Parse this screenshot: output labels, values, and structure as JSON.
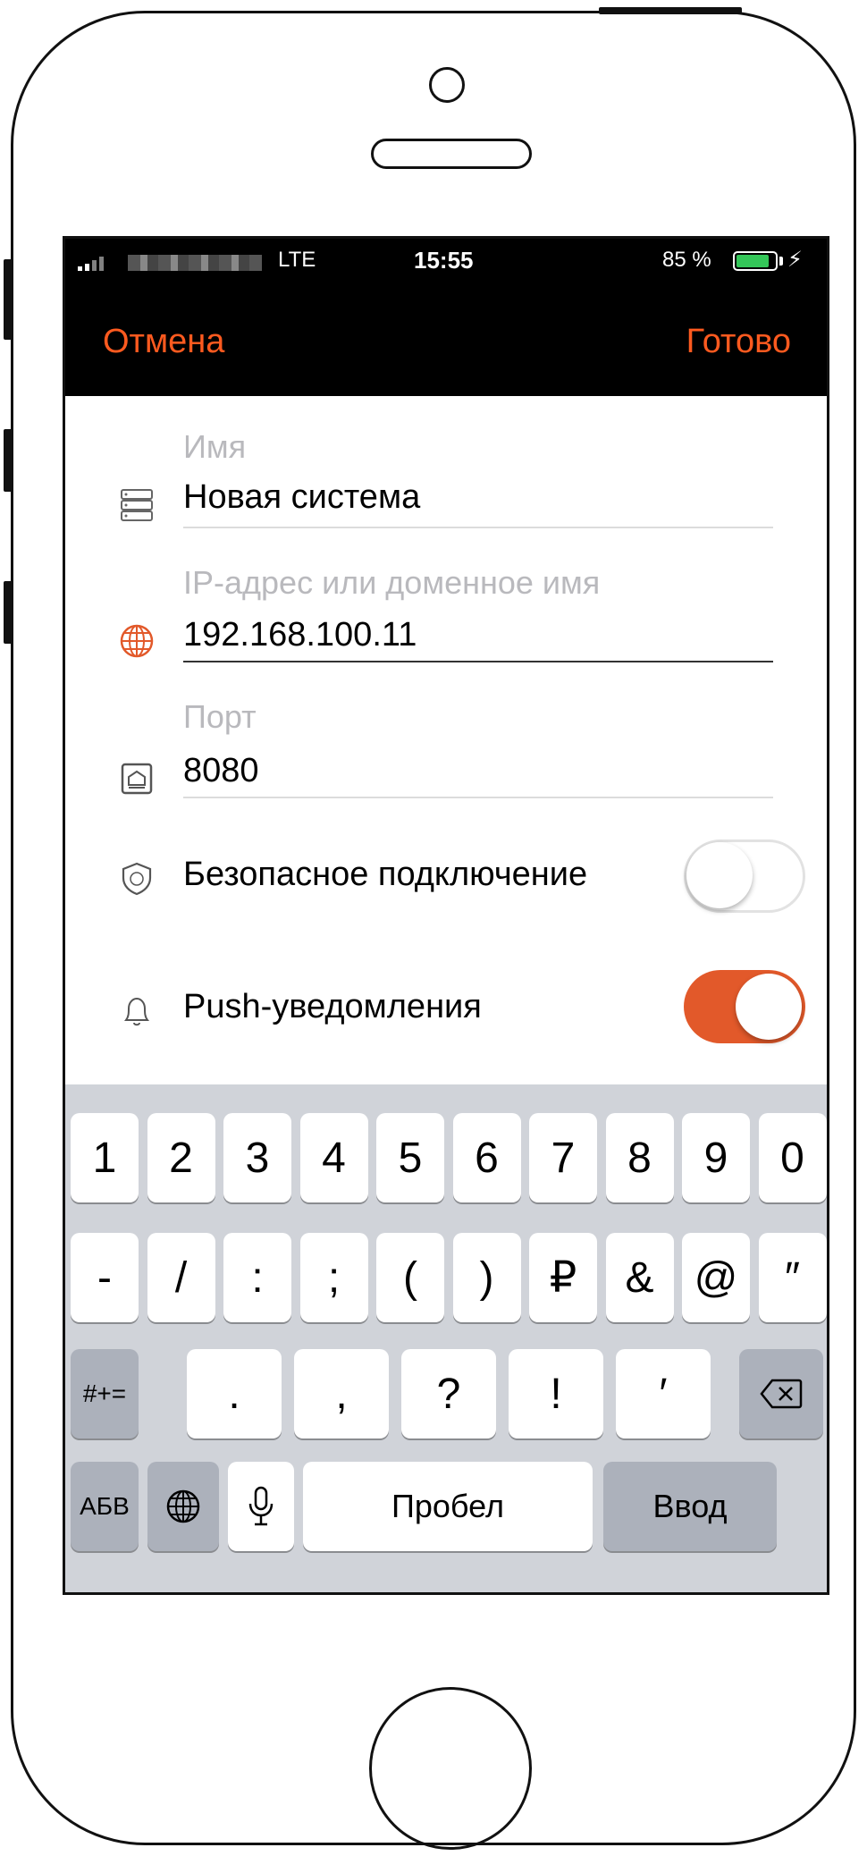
{
  "status_bar": {
    "network": "LTE",
    "time": "15:55",
    "battery": "85 %",
    "battery_level": 0.85,
    "charging_symbol": "⚡"
  },
  "nav": {
    "cancel": "Отмена",
    "done": "Готово",
    "accent_color": "#ff5a1f"
  },
  "form": {
    "name": {
      "label": "Имя",
      "value": "Новая система",
      "icon": "server-icon"
    },
    "address": {
      "label": "IP-адрес или доменное имя",
      "value": "192.168.100.11",
      "icon": "globe-icon"
    },
    "port": {
      "label": "Порт",
      "value": "8080",
      "icon": "port-icon"
    },
    "secure": {
      "label": "Безопасное подключение",
      "on": false,
      "icon": "ssl-shield-icon"
    },
    "push": {
      "label": "Push-уведомления",
      "on": true,
      "icon": "bell-icon",
      "toggle_color": "#e2592a"
    }
  },
  "keyboard": {
    "row1": [
      "1",
      "2",
      "3",
      "4",
      "5",
      "6",
      "7",
      "8",
      "9",
      "0"
    ],
    "row2": [
      "-",
      "/",
      ":",
      ";",
      "(",
      ")",
      "₽",
      "&",
      "@",
      "″"
    ],
    "row3_mode": "#+=",
    "row3": [
      ".",
      ",",
      "?",
      "!",
      "′"
    ],
    "backspace": "⌫",
    "abc": "АБВ",
    "space": "Пробел",
    "return": "Ввод"
  }
}
